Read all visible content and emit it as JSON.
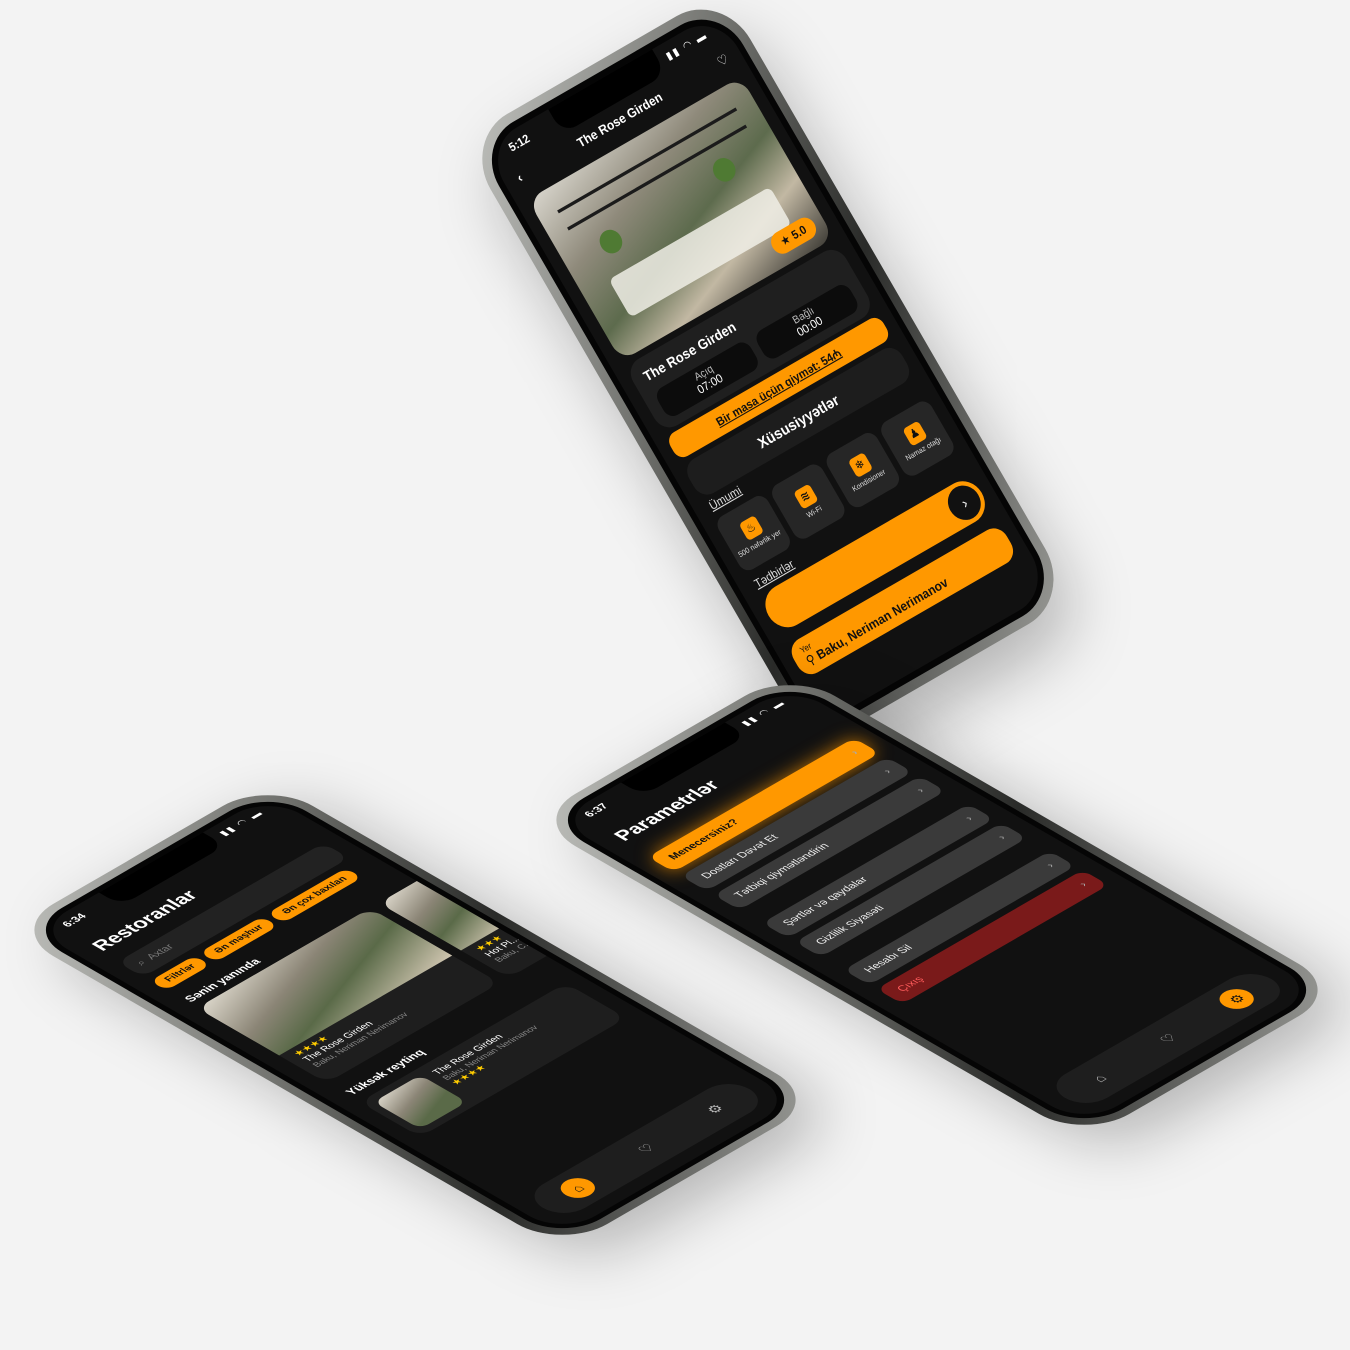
{
  "detail": {
    "status_time": "5:12",
    "title": "The Rose Girden",
    "rating": "5.0",
    "name": "The Rose Girden",
    "open_label": "Açıq",
    "open_time": "07:00",
    "close_label": "Bağlı",
    "close_time": "00:00",
    "price": "Bir masa üçün qiymət: 54₼",
    "features_title": "Xüsusiyyətlər",
    "section_general": "Ümumi",
    "section_events": "Tədbirlər",
    "features": [
      {
        "glyph": "♨",
        "label": "500 nəfərlik yer"
      },
      {
        "glyph": "≋",
        "label": "Wi-Fi"
      },
      {
        "glyph": "❄",
        "label": "Kondisioner"
      },
      {
        "glyph": "♟",
        "label": "Namaz otağı"
      }
    ],
    "location_label": "Yer",
    "location_value": "Baku, Neriman Nerimanov"
  },
  "home": {
    "status_time": "6:34",
    "title": "Restoranlar",
    "search_placeholder": "Axtar",
    "chips": [
      "Filtrlər",
      "Ən məşhur",
      "Ən çox baxılan"
    ],
    "nearby_title": "Sənin yanında",
    "cards": [
      {
        "stars": "★★★★",
        "name": "The Rose Girden",
        "address": "Baku, Neriman Nerimanov"
      },
      {
        "stars": "★★★",
        "name": "Hot Pl...",
        "address": "Baku, C..."
      }
    ],
    "top_title": "Yüksək reytinq",
    "top_item": {
      "name": "The Rose Girden",
      "address": "Baku, Neriman Nerimanov",
      "stars": "★★★★"
    }
  },
  "settings": {
    "status_time": "6:37",
    "title": "Parametrlər",
    "items": [
      {
        "label": "Menecersiniz?",
        "style": "accent"
      },
      {
        "label": "Dostları Dəvət Et",
        "style": "normal"
      },
      {
        "label": "Tətbiqi qiymətləndirin",
        "style": "normal"
      },
      {
        "label": "Şərtlər və qaydalar",
        "style": "normal"
      },
      {
        "label": "Gizlilik Siyasəti",
        "style": "normal"
      },
      {
        "label": "Hesabı Sil",
        "style": "normal"
      },
      {
        "label": "Çıxış",
        "style": "danger"
      }
    ]
  },
  "colors": {
    "accent": "#ff9800",
    "danger": "#7a1a1a",
    "background": "#111111"
  },
  "icons": [
    "back-arrow-icon",
    "heart-icon",
    "star-icon",
    "search-icon",
    "filter-icon",
    "home-icon",
    "settings-icon",
    "location-pin-icon",
    "chevron-right-icon"
  ]
}
